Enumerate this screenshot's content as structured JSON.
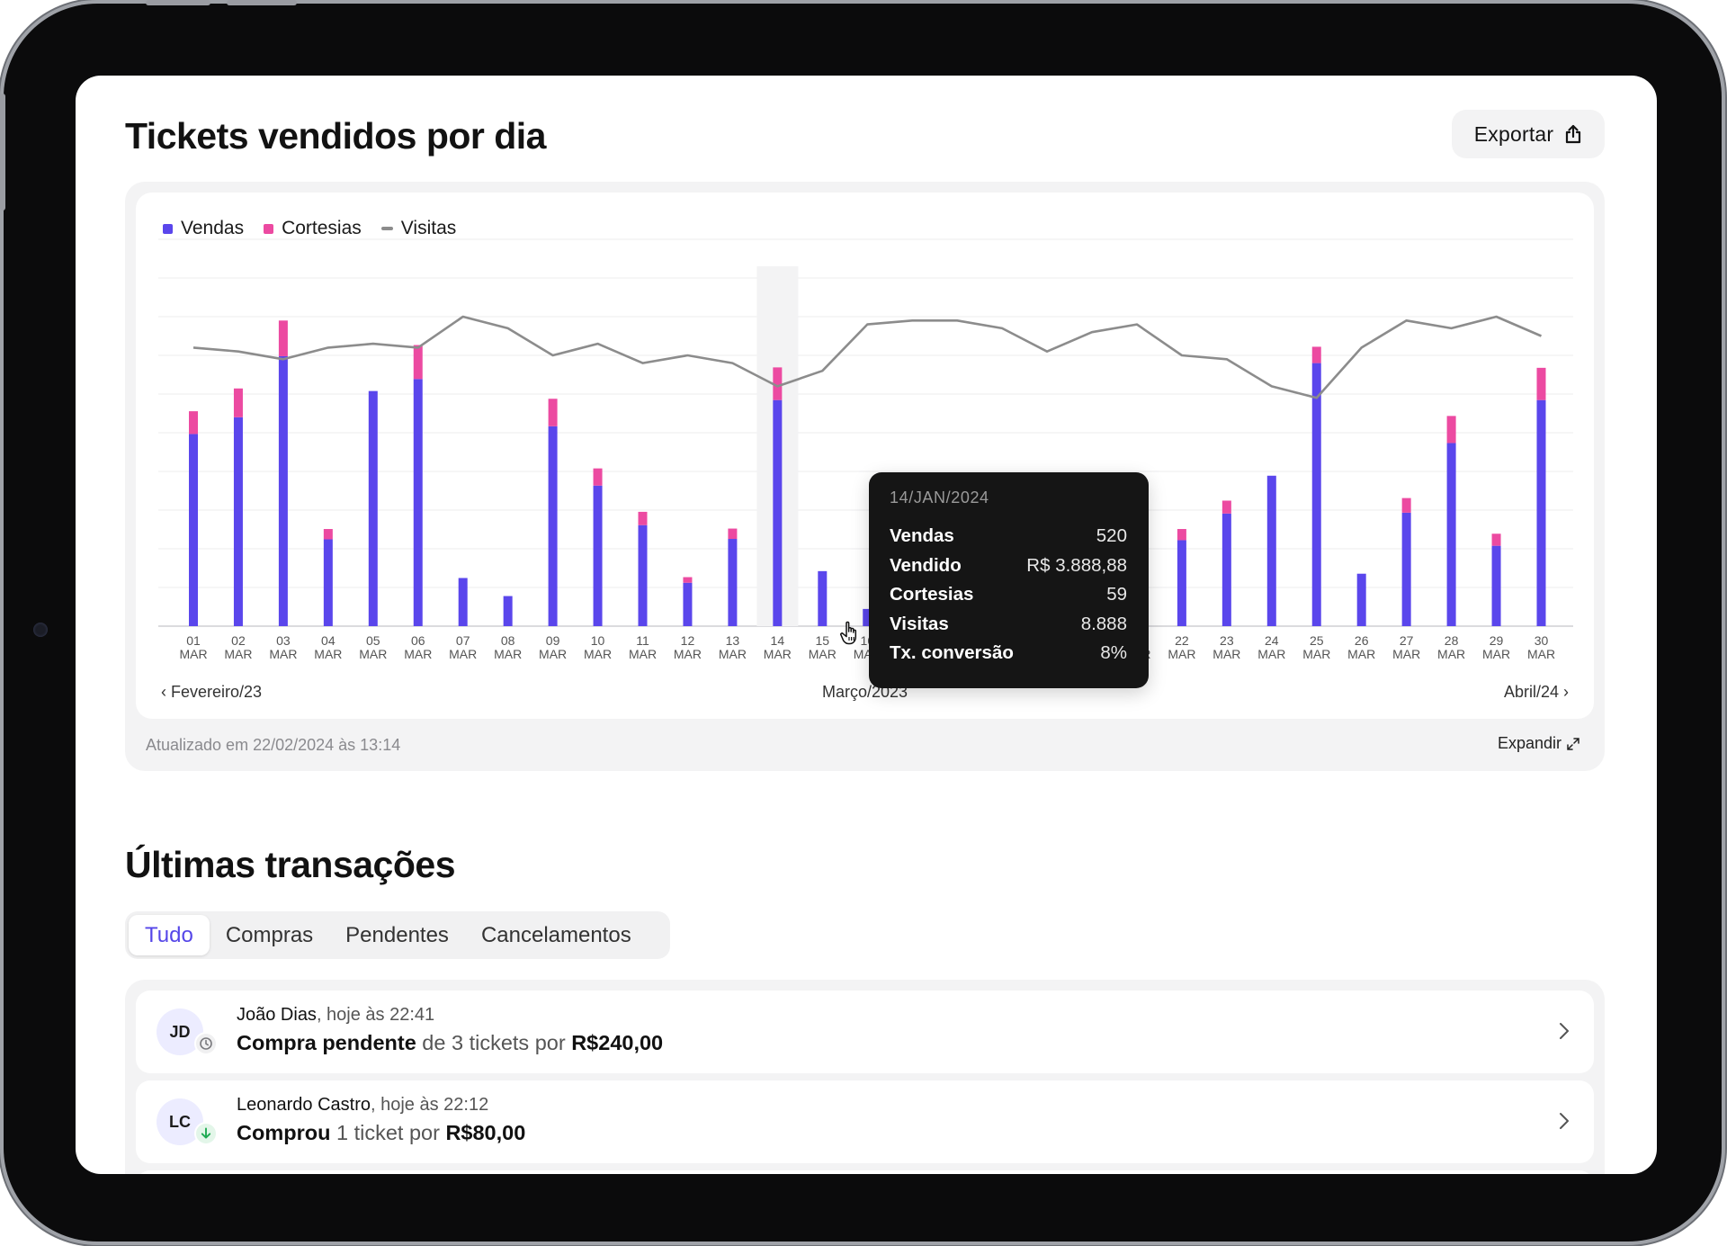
{
  "chart_section": {
    "title": "Tickets vendidos por dia",
    "export_label": "Exportar",
    "updated_text": "Atualizado em 22/02/2024 às 13:14",
    "expand_label": "Expandir",
    "prev_month": "Fevereiro/23",
    "current_month": "Março/2023",
    "next_month": "Abril/24"
  },
  "legend": {
    "vendas": "Vendas",
    "cortesias": "Cortesias",
    "visitas": "Visitas"
  },
  "colors": {
    "vendas": "#5a46ec",
    "cortesias": "#ec4aa1",
    "visitas": "#8c8c8c",
    "accent": "#5546e8"
  },
  "tooltip": {
    "date": "14/JAN/2024",
    "rows": [
      {
        "label": "Vendas",
        "value": "520"
      },
      {
        "label": "Vendido",
        "value": "R$ 3.888,88"
      },
      {
        "label": "Cortesias",
        "value": "59"
      },
      {
        "label": "Visitas",
        "value": "8.888"
      },
      {
        "label": "Tx. conversão",
        "value": "8%"
      }
    ]
  },
  "chart_data": {
    "type": "bar",
    "categories": [
      "01",
      "02",
      "03",
      "04",
      "05",
      "06",
      "07",
      "08",
      "09",
      "10",
      "11",
      "12",
      "13",
      "14",
      "15",
      "16",
      "17",
      "18",
      "19",
      "19",
      "20",
      "21",
      "22",
      "23",
      "24",
      "25",
      "26",
      "27",
      "28",
      "29",
      "30"
    ],
    "category_sublabel": "MAR",
    "series": [
      {
        "name": "Vendas",
        "type": "bar",
        "stack": "tickets",
        "values": [
          447,
          486,
          628,
          202,
          547,
          575,
          112,
          70,
          465,
          327,
          235,
          101,
          203,
          526,
          128,
          40,
          103,
          60,
          210,
          218,
          312,
          122,
          200,
          262,
          350,
          612,
          122,
          264,
          426,
          187,
          526
        ]
      },
      {
        "name": "Cortesias",
        "type": "bar",
        "stack": "tickets",
        "values": [
          53,
          67,
          83,
          24,
          0,
          79,
          0,
          0,
          64,
          40,
          31,
          13,
          24,
          76,
          0,
          0,
          14,
          8,
          0,
          24,
          29,
          0,
          26,
          30,
          0,
          38,
          0,
          34,
          63,
          28,
          75
        ]
      },
      {
        "name": "Visitas",
        "type": "line",
        "values": [
          72,
          71,
          69,
          72,
          73,
          72,
          80,
          77,
          70,
          73,
          68,
          70,
          68,
          62,
          66,
          78,
          79,
          79,
          77,
          71,
          76,
          78,
          70,
          69,
          62,
          59,
          72,
          79,
          77,
          80,
          75
        ]
      }
    ],
    "y_bars": [
      0,
      900
    ],
    "y_line": [
      0,
      100
    ],
    "highlight_index": 13,
    "grid": true,
    "legend_position": "top-left"
  },
  "transactions": {
    "title": "Últimas transações",
    "tabs": [
      "Tudo",
      "Compras",
      "Pendentes",
      "Cancelamentos"
    ],
    "active_tab": "Tudo",
    "items": [
      {
        "initials": "JD",
        "name": "João Dias",
        "time": ", hoje às 22:41",
        "action": "Compra pendente",
        "mid": " de 3 tickets por ",
        "amount": "R$240,00",
        "status_icon": "clock-icon"
      },
      {
        "initials": "LC",
        "name": "Leonardo Castro",
        "time": ", hoje às 22:12",
        "action": "Comprou",
        "mid": " 1 ticket por ",
        "amount": "R$80,00",
        "status_icon": "arrow-down-icon"
      }
    ]
  }
}
